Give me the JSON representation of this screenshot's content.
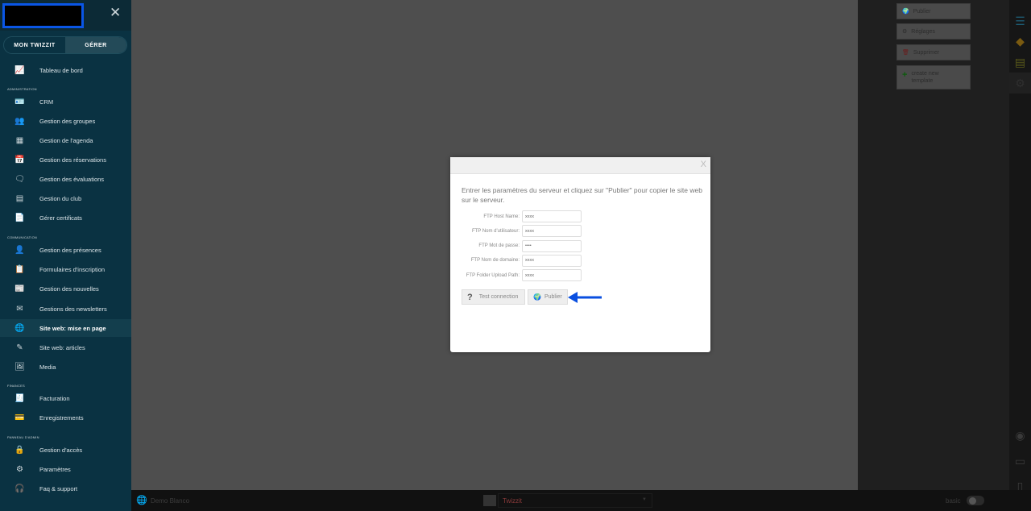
{
  "sidebar": {
    "close": "✕",
    "toggle": {
      "left": "MON TWIZZIT",
      "right": "GÉRER"
    },
    "sections": {
      "admin": "ADMINISTRATION",
      "comm": "COMMUNICATION",
      "fin": "FINANCES",
      "panel": "PANNEAU D'ADMIN"
    },
    "items": [
      {
        "label": "Tableau de bord",
        "icon": "📈"
      },
      {
        "label": "CRM",
        "icon": "🪪"
      },
      {
        "label": "Gestion des groupes",
        "icon": "👥"
      },
      {
        "label": "Gestion de l'agenda",
        "icon": "▦"
      },
      {
        "label": "Gestion des réservations",
        "icon": "📅"
      },
      {
        "label": "Gestion des évaluations",
        "icon": "🗨"
      },
      {
        "label": "Gestion du club",
        "icon": "▤"
      },
      {
        "label": "Gérer certificats",
        "icon": "📄"
      },
      {
        "label": "Gestion des présences",
        "icon": "👤"
      },
      {
        "label": "Formulaires d'inscription",
        "icon": "📋"
      },
      {
        "label": "Gestion des nouvelles",
        "icon": "📰"
      },
      {
        "label": "Gestions des newsletters",
        "icon": "✉"
      },
      {
        "label": "Site web: mise en page",
        "icon": "🌐"
      },
      {
        "label": "Site web: articles",
        "icon": "✎"
      },
      {
        "label": "Media",
        "icon": "🖼"
      },
      {
        "label": "Facturation",
        "icon": "🧾"
      },
      {
        "label": "Enregistrements",
        "icon": "💳"
      },
      {
        "label": "Gestion d'accès",
        "icon": "🔒"
      },
      {
        "label": "Paramètres",
        "icon": "⚙"
      },
      {
        "label": "Faq & support",
        "icon": "🎧"
      }
    ]
  },
  "right_panel": {
    "buttons": [
      "Publier",
      "Réglages",
      "Supprimer",
      "create new template"
    ]
  },
  "bottom": {
    "site": "Demo Blanco",
    "template": "Twizzit",
    "mode": "basic"
  },
  "modal": {
    "close": "X",
    "instructions": "Entrer les paramètres du serveur et cliquez sur \"Publier\" pour copier le site web sur le serveur.",
    "fields": [
      {
        "label": "FTP Host Name:",
        "value": "xxxx"
      },
      {
        "label": "FTP Nom d'utilisateur:",
        "value": "xxxx"
      },
      {
        "label": "FTP Mot de passe:",
        "value": "••••"
      },
      {
        "label": "FTP Nom de domaine:",
        "value": "xxxx"
      },
      {
        "label": "FTP Folder Upload Path:",
        "value": "xxxx"
      }
    ],
    "test_button": "Test connection",
    "publish_button": "Publier"
  }
}
